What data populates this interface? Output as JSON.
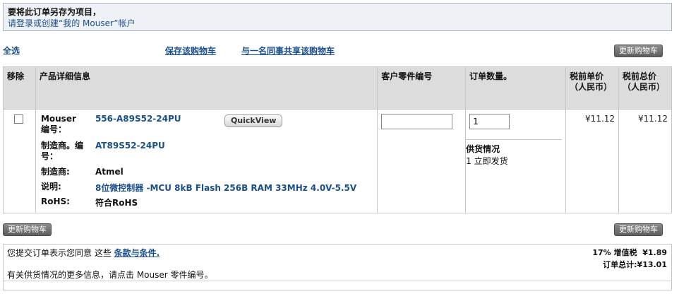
{
  "banner": {
    "line1": "要将此订单另存为项目，",
    "line2": "请登录或创建“我的 Mouser”帐户"
  },
  "links": {
    "select_all": "全选",
    "save_cart": "保存该购物车",
    "share_cart": "与一名同事共享该购物车"
  },
  "buttons": {
    "update_cart": "更新购物车"
  },
  "table": {
    "headers": {
      "remove": "移除",
      "details": "产品详细信息",
      "customer_part": "客户零件编号",
      "quantity": "订单数量。",
      "unit_price": "税前单价（人民币）",
      "total_price": "税前总价（人民币）"
    },
    "row": {
      "labels": {
        "mouser_no": "Mouser 编号：",
        "mfr_no": "制造商。编号：",
        "mfr": "制造商:",
        "desc": "说明:",
        "rohs": "RoHS:"
      },
      "values": {
        "mouser_no": "556-A89S52-24PU",
        "mfr_no": "AT89S52-24PU",
        "mfr": "Atmel",
        "desc": "8位微控制器 -MCU 8kB Flash 256B RAM 33MHz 4.0V-5.5V",
        "rohs": "符合RoHS"
      },
      "quickview": "QuickView",
      "customer_part_value": "",
      "quantity_value": "1",
      "availability_title": "供货情况",
      "availability_value": "1 立即发货",
      "unit_price": "¥11.12",
      "total_price": "¥11.12"
    }
  },
  "summary": {
    "agree_prefix": "您提交订单表示您同意 这些 ",
    "agree_link": "条款与条件.",
    "availability_note": "有关供货情况的更多信息，请点击 Mouser 零件编号。",
    "tax_label": "17% 增值税",
    "tax_value": "¥1.89",
    "total_label": "订单总计:",
    "total_value": "¥13.01"
  }
}
